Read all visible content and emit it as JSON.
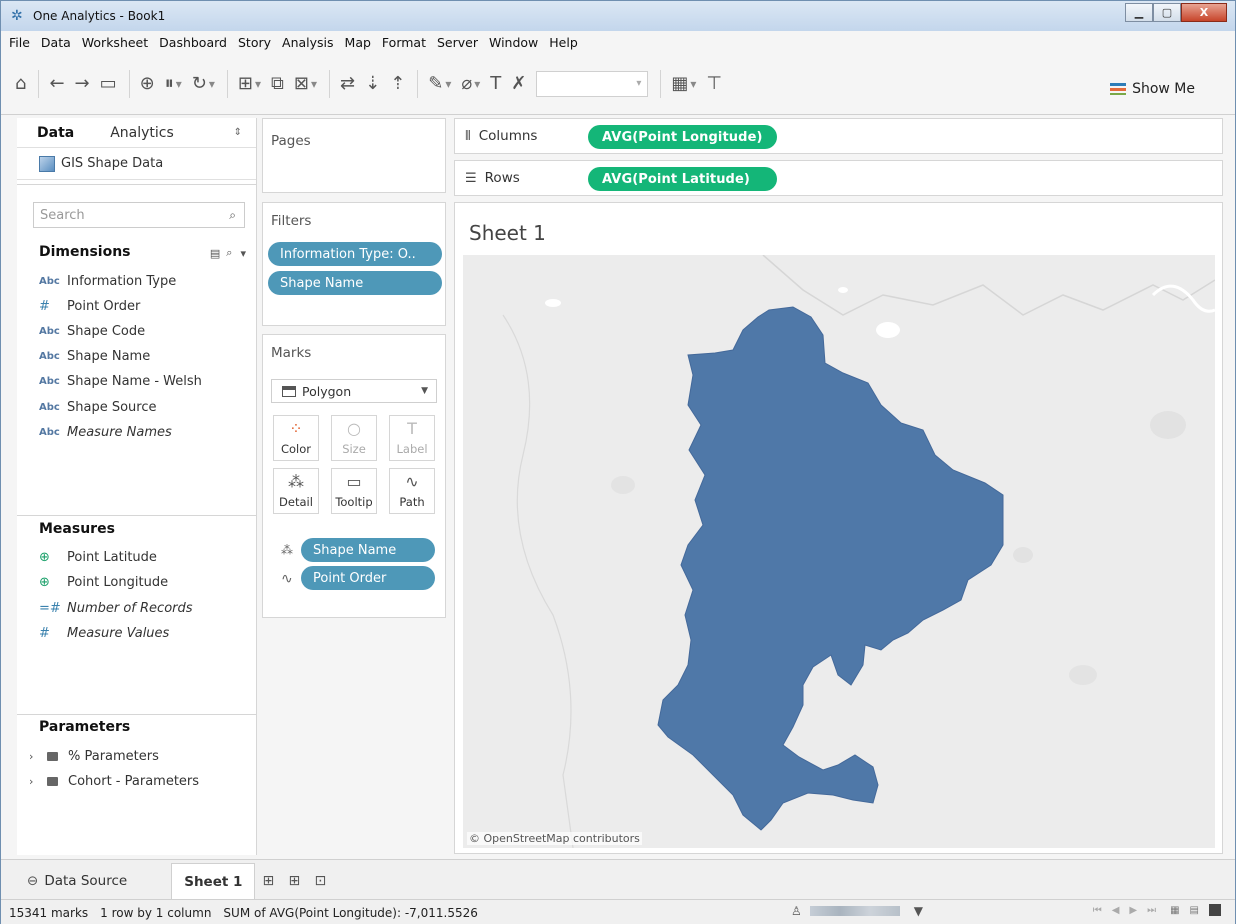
{
  "window": {
    "title": "One Analytics - Book1"
  },
  "menu": [
    "File",
    "Data",
    "Worksheet",
    "Dashboard",
    "Story",
    "Analysis",
    "Map",
    "Format",
    "Server",
    "Window",
    "Help"
  ],
  "toolbar": {
    "show_me_label": "Show Me"
  },
  "data_pane": {
    "tabs": [
      "Data",
      "Analytics"
    ],
    "datasource": "GIS Shape Data",
    "search_placeholder": "Search",
    "dimensions_label": "Dimensions",
    "dimensions": [
      {
        "type": "Abc",
        "label": "Information Type"
      },
      {
        "type": "#",
        "label": "Point Order"
      },
      {
        "type": "Abc",
        "label": "Shape Code"
      },
      {
        "type": "Abc",
        "label": "Shape Name"
      },
      {
        "type": "Abc",
        "label": "Shape Name - Welsh"
      },
      {
        "type": "Abc",
        "label": "Shape Source"
      },
      {
        "type": "Abc",
        "label": "Measure Names"
      }
    ],
    "measures_label": "Measures",
    "measures": [
      {
        "type": "globe",
        "label": "Point Latitude"
      },
      {
        "type": "globe",
        "label": "Point Longitude"
      },
      {
        "type": "=#",
        "label": "Number of Records"
      },
      {
        "type": "#",
        "label": "Measure Values"
      }
    ],
    "parameters_label": "Parameters",
    "parameters": [
      "% Parameters",
      "Cohort - Parameters"
    ]
  },
  "cards": {
    "pages_label": "Pages",
    "filters_label": "Filters",
    "filters": [
      "Information Type: O..",
      "Shape Name"
    ],
    "marks_label": "Marks",
    "mark_type": "Polygon",
    "mark_buttons": [
      "Color",
      "Size",
      "Label",
      "Detail",
      "Tooltip",
      "Path"
    ],
    "mark_pills": [
      "Shape Name",
      "Point Order"
    ]
  },
  "shelves": {
    "columns_label": "Columns",
    "columns_pill": "AVG(Point Longitude)",
    "rows_label": "Rows",
    "rows_pill": "AVG(Point Latitude)"
  },
  "view": {
    "sheet_title": "Sheet 1",
    "attribution": "© OpenStreetMap contributors",
    "polygon_color": "#4f78a8"
  },
  "bottom_tabs": {
    "data_source": "Data Source",
    "sheet": "Sheet 1"
  },
  "status": {
    "marks": "15341 marks",
    "dims": "1 row by 1 column",
    "sum": "SUM of AVG(Point Longitude): -7,011.5526"
  }
}
